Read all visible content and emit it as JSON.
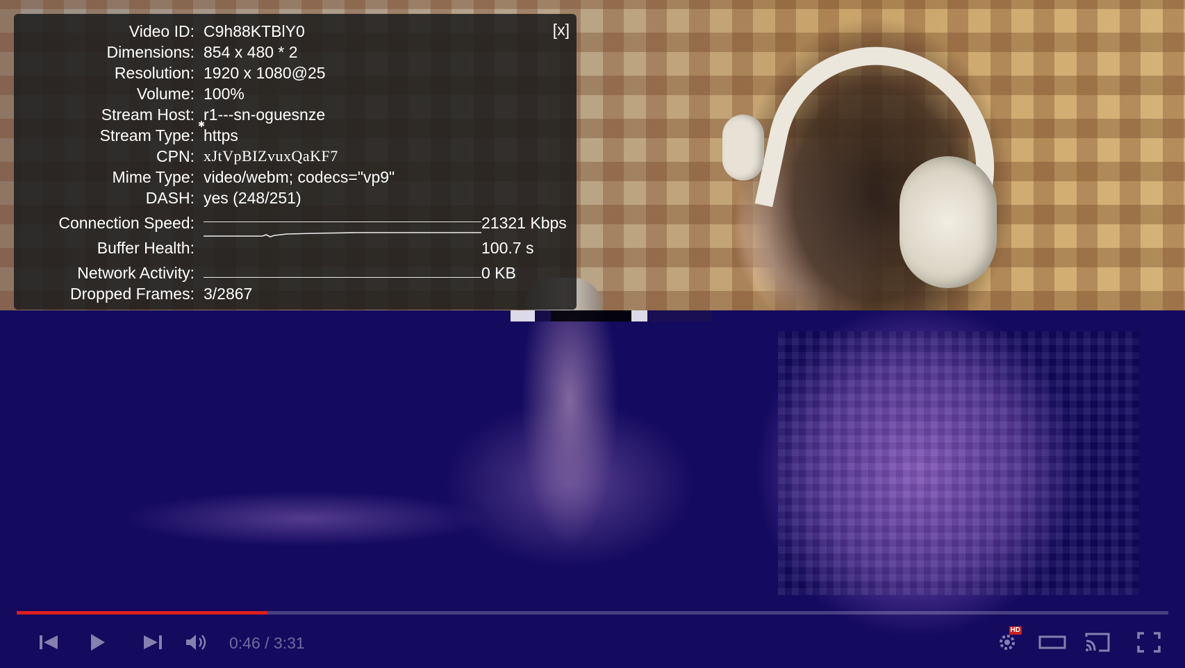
{
  "stats": {
    "close_label": "[x]",
    "rows": [
      {
        "label": "Video ID:",
        "value": "C9h88KTBlY0"
      },
      {
        "label": "Dimensions:",
        "value": "854 x 480 * 2"
      },
      {
        "label": "Resolution:",
        "value": "1920 x 1080@25"
      },
      {
        "label": "Volume:",
        "value": "100%"
      },
      {
        "label": "Stream Host:",
        "value": "r1---sn-oguesnze"
      },
      {
        "label": "Stream Type:",
        "value": "https"
      },
      {
        "label": "CPN:",
        "value": "xJtVpBIZvuxQaKF7"
      },
      {
        "label": "Mime Type:",
        "value": "video/webm; codecs=\"vp9\""
      },
      {
        "label": "DASH:",
        "value": "yes (248/251)"
      }
    ],
    "graphs": [
      {
        "label": "Connection Speed:",
        "readout": "21321 Kbps"
      },
      {
        "label": "Buffer Health:",
        "readout": "100.7 s"
      },
      {
        "label": "Network Activity:",
        "readout": "0 KB"
      }
    ],
    "dropped_frames": {
      "label": "Dropped Frames:",
      "value": "3/2867"
    }
  },
  "player": {
    "time": "0:46 / 3:31",
    "progress_fraction": 0.218,
    "hd_badge": "HD",
    "controls": {
      "previous": "previous-icon",
      "play": "play-icon",
      "next": "next-icon",
      "volume": "volume-icon",
      "settings": "settings-icon",
      "theater": "theater-mode-icon",
      "cast": "cast-icon",
      "fullscreen": "fullscreen-icon"
    },
    "accent_color": "#d9201f"
  }
}
